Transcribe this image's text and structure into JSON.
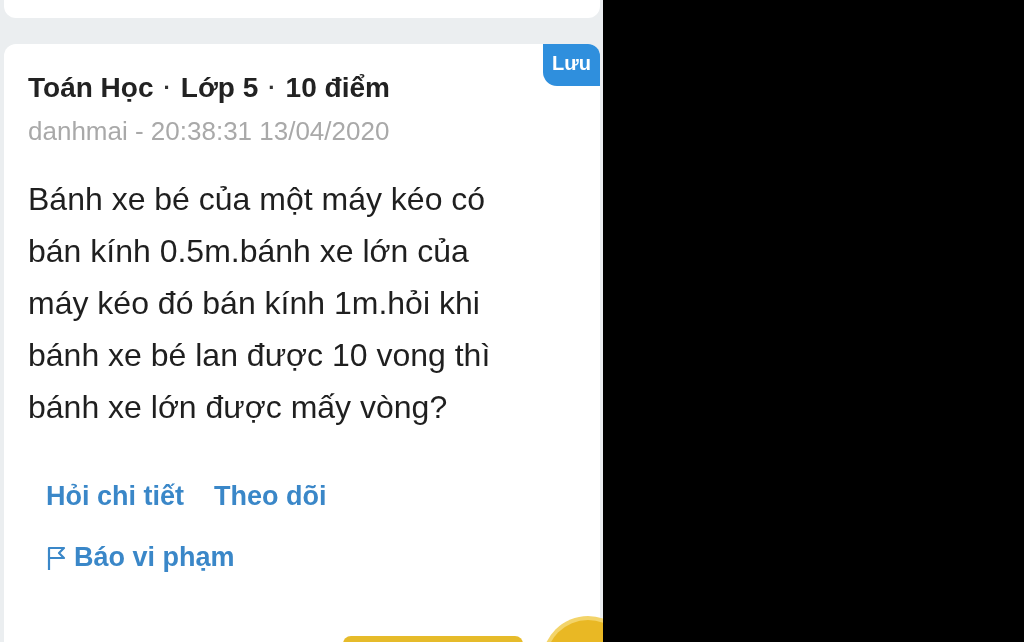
{
  "question": {
    "save_label": "Lưu",
    "separator": "·",
    "tags": [
      "Toán Học",
      "Lớp 5",
      "10 điểm"
    ],
    "meta": "danhmai - 20:38:31 13/04/2020",
    "text_lines": [
      "Bánh xe bé của một máy kéo có",
      "bán kính 0.5m.bánh xe lớn của",
      "máy kéo đó bán kính 1m.hỏi khi",
      "bánh xe bé lan được 10 vong thì",
      "bánh xe lớn được mấy vòng?"
    ],
    "actions": [
      "Hỏi chi tiết",
      "Theo dõi"
    ],
    "report": "Báo vi phạm"
  }
}
